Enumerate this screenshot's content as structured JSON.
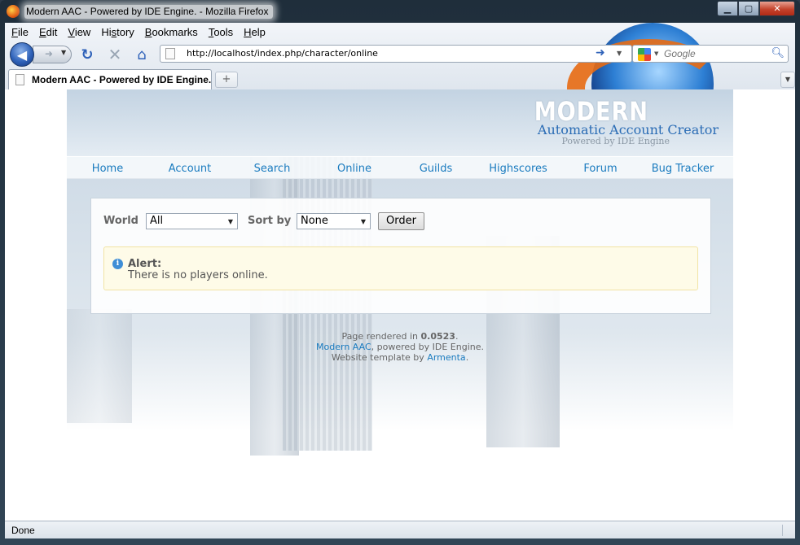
{
  "window": {
    "title": "Modern AAC - Powered by IDE Engine. - Mozilla Firefox"
  },
  "menu": {
    "items": [
      {
        "first": "F",
        "rest": "ile"
      },
      {
        "first": "E",
        "rest": "dit"
      },
      {
        "first": "V",
        "rest": "iew"
      },
      {
        "first": "",
        "pre": "Hi",
        "u": "s",
        "post": "tory"
      },
      {
        "first": "B",
        "rest": "ookmarks"
      },
      {
        "first": "T",
        "rest": "ools"
      },
      {
        "first": "H",
        "rest": "elp"
      }
    ]
  },
  "toolbar": {
    "url": "http://localhost/index.php/character/online",
    "search_placeholder": "Google"
  },
  "tabs": {
    "active_label": "Modern AAC - Powered by IDE Engine.",
    "new_tab_symbol": "+"
  },
  "site": {
    "logo_title": "MODERN",
    "logo_subtitle": "Automatic Account Creator",
    "logo_powered": "Powered by IDE Engine",
    "nav": [
      "Home",
      "Account",
      "Search",
      "Online",
      "Guilds",
      "Highscores",
      "Forum",
      "Bug Tracker"
    ],
    "filter": {
      "world_label": "World",
      "world_value": "All",
      "sort_label": "Sort by",
      "sort_value": "None",
      "order_button": "Order"
    },
    "alert": {
      "title": "Alert:",
      "message": "There is no players online."
    },
    "footer": {
      "rendered_prefix": "Page rendered in ",
      "rendered_time": "0.0523",
      "rendered_suffix": ".",
      "brand_link": "Modern AAC",
      "brand_suffix": ", powered by IDE Engine.",
      "template_prefix": "Website template by ",
      "template_link": "Armenta",
      "template_suffix": "."
    }
  },
  "status": {
    "text": "Done"
  },
  "colors": {
    "link": "#1a7bbf",
    "logo_subtitle": "#2a6cb5",
    "alert_bg": "#fefbe8"
  }
}
